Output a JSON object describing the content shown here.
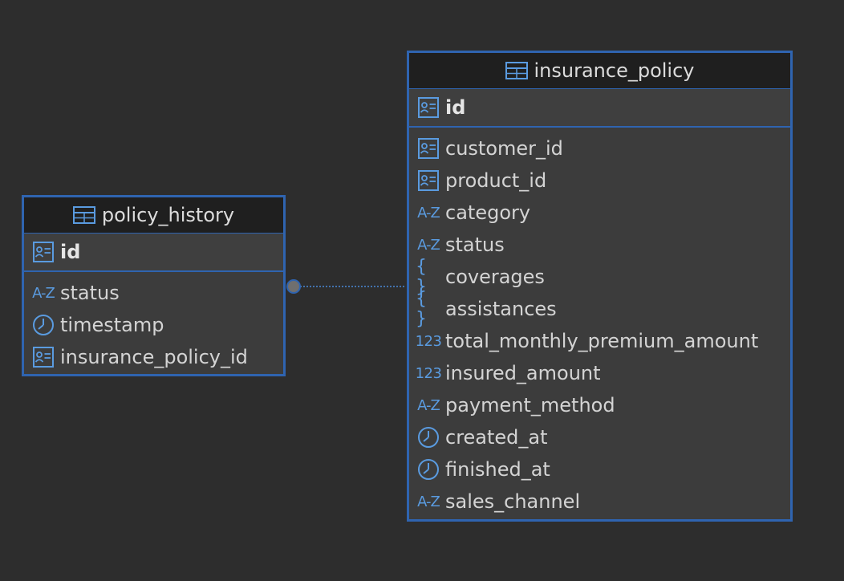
{
  "tables": [
    {
      "name": "policy_history",
      "pk": "id",
      "columns": [
        {
          "name": "status",
          "type_icon": "text-type-icon",
          "type_text": "A-Z"
        },
        {
          "name": "timestamp",
          "type_icon": "clock-icon"
        },
        {
          "name": "insurance_policy_id",
          "type_icon": "id-card-icon"
        }
      ]
    },
    {
      "name": "insurance_policy",
      "pk": "id",
      "columns": [
        {
          "name": "customer_id",
          "type_icon": "id-card-icon"
        },
        {
          "name": "product_id",
          "type_icon": "id-card-icon"
        },
        {
          "name": "category",
          "type_icon": "text-type-icon",
          "type_text": "A-Z"
        },
        {
          "name": "status",
          "type_icon": "text-type-icon",
          "type_text": "A-Z"
        },
        {
          "name": "coverages",
          "type_icon": "json-type-icon",
          "type_text": "{ }"
        },
        {
          "name": "assistances",
          "type_icon": "json-type-icon",
          "type_text": "{ }"
        },
        {
          "name": "total_monthly_premium_amount",
          "type_icon": "number-type-icon",
          "type_text": "123"
        },
        {
          "name": "insured_amount",
          "type_icon": "number-type-icon",
          "type_text": "123"
        },
        {
          "name": "payment_method",
          "type_icon": "text-type-icon",
          "type_text": "A-Z"
        },
        {
          "name": "created_at",
          "type_icon": "clock-icon"
        },
        {
          "name": "finished_at",
          "type_icon": "clock-icon"
        },
        {
          "name": "sales_channel",
          "type_icon": "text-type-icon",
          "type_text": "A-Z"
        }
      ]
    }
  ],
  "colors": {
    "background": "#2d2d2d",
    "entity_border": "#2f64b0",
    "icon": "#5a9be0"
  }
}
